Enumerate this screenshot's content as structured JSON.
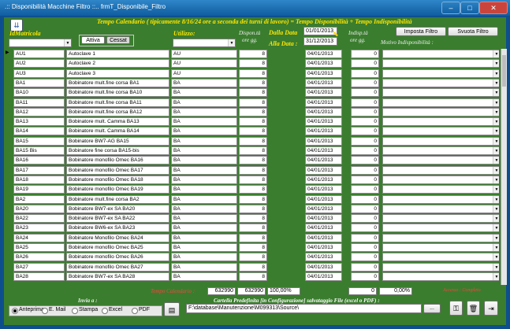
{
  "window": {
    "title": ".:: Disponibilità Macchine Filtro ::..   frmT_Disponibile_Filtro"
  },
  "header": {
    "banner": "Tempo Calendario ( tipicamente  8/16/24 ore a seconda dei turni di lavoro) = Tempo Disponibilità + Tempo Indisponibilità",
    "matricola_label": "IdMatricola",
    "attiva": "Attiva",
    "cessat": "Cessat",
    "utilizzo_label": "Utilizzo:",
    "dispon_label": "Dispon.tà",
    "ore_gg": "ore gg.",
    "dalla_data_label": "Dalla Data",
    "alla_data_label": "Alla Data :",
    "dalla_data": "01/01/2013",
    "alla_data": "31/12/2013",
    "indisp_label": "Indisp.tà",
    "motivo_label": "Motivo Indisponibilità :",
    "imposta_filtro": "Imposta Filtro",
    "svuota_filtro": "Svuota Filtro"
  },
  "rows": [
    {
      "id": "AU1",
      "desc": "Autoclave 1",
      "util": "AU",
      "ore": "8",
      "data": "04/01/2013",
      "indisp": "0"
    },
    {
      "id": "AU2",
      "desc": "Autoclave 2",
      "util": "AU",
      "ore": "8",
      "data": "04/01/2013",
      "indisp": "0"
    },
    {
      "id": "AU3",
      "desc": "Autoclave 3",
      "util": "AU",
      "ore": "8",
      "data": "04/01/2013",
      "indisp": "0"
    },
    {
      "id": "BA1",
      "desc": "Bobinatore mult.fine corsa BA1",
      "util": "BA",
      "ore": "8",
      "data": "04/01/2013",
      "indisp": "0"
    },
    {
      "id": "BA10",
      "desc": "Bobinatore mult.fine corsa BA10",
      "util": "BA",
      "ore": "8",
      "data": "04/01/2013",
      "indisp": "0"
    },
    {
      "id": "BA11",
      "desc": "Bobinatore mult.fine corsa BA11",
      "util": "BA",
      "ore": "8",
      "data": "04/01/2013",
      "indisp": "0"
    },
    {
      "id": "BA12",
      "desc": "Bobinatore mult.fine corsa BA12",
      "util": "BA",
      "ore": "8",
      "data": "04/01/2013",
      "indisp": "0"
    },
    {
      "id": "BA13",
      "desc": "Bobinatore mult. Camma BA13",
      "util": "BA",
      "ore": "8",
      "data": "04/01/2013",
      "indisp": "0"
    },
    {
      "id": "BA14",
      "desc": "Bobinatore mult. Camma BA14",
      "util": "BA",
      "ore": "8",
      "data": "04/01/2013",
      "indisp": "0"
    },
    {
      "id": "BA15",
      "desc": "Bobinatore BW7-AG BA15",
      "util": "BA",
      "ore": "8",
      "data": "04/01/2013",
      "indisp": "0"
    },
    {
      "id": "BA15 Bis",
      "desc": "Bobinatore fine corsa BA15-bis",
      "util": "BA",
      "ore": "8",
      "data": "04/01/2013",
      "indisp": "0"
    },
    {
      "id": "BA16",
      "desc": "Bobinatore monofilo Omec BA16",
      "util": "BA",
      "ore": "8",
      "data": "04/01/2013",
      "indisp": "0"
    },
    {
      "id": "BA17",
      "desc": "Bobinatore monofilo Omec BA17",
      "util": "BA",
      "ore": "8",
      "data": "04/01/2013",
      "indisp": "0"
    },
    {
      "id": "BA18",
      "desc": "Bobinatore monofilo Omec BA18",
      "util": "BA",
      "ore": "8",
      "data": "04/01/2013",
      "indisp": "0"
    },
    {
      "id": "BA19",
      "desc": "Bobinatore monofilo Omec BA19",
      "util": "BA",
      "ore": "8",
      "data": "04/01/2013",
      "indisp": "0"
    },
    {
      "id": "BA2",
      "desc": "Bobinatore mult.fine corsa BA2",
      "util": "BA",
      "ore": "8",
      "data": "04/01/2013",
      "indisp": "0"
    },
    {
      "id": "BA20",
      "desc": "Bobinatore BW7-ex SA BA20",
      "util": "BA",
      "ore": "8",
      "data": "04/01/2013",
      "indisp": "0"
    },
    {
      "id": "BA22",
      "desc": "Bobinatore BW7-ex SA BA22",
      "util": "BA",
      "ore": "8",
      "data": "04/01/2013",
      "indisp": "0"
    },
    {
      "id": "BA23",
      "desc": "Bobinatore BW6-ex SA BA23",
      "util": "BA",
      "ore": "8",
      "data": "04/01/2013",
      "indisp": "0"
    },
    {
      "id": "BA24",
      "desc": "Bobinatore Monofilo Omec BA24",
      "util": "BA",
      "ore": "8",
      "data": "04/01/2013",
      "indisp": "0"
    },
    {
      "id": "BA25",
      "desc": "Bobinatore monofilo Omec BA25",
      "util": "BA",
      "ore": "8",
      "data": "04/01/2013",
      "indisp": "0"
    },
    {
      "id": "BA26",
      "desc": "Bobinatore monofilo Omec BA26",
      "util": "BA",
      "ore": "8",
      "data": "04/01/2013",
      "indisp": "0"
    },
    {
      "id": "BA27",
      "desc": "Bobinatore monofilo Omec BA27",
      "util": "BA",
      "ore": "8",
      "data": "04/01/2013",
      "indisp": "0"
    },
    {
      "id": "BA28",
      "desc": "Bobinatore BW7-ex SA BA28",
      "util": "BA",
      "ore": "8",
      "data": "04/01/2013",
      "indisp": "0"
    }
  ],
  "footer": {
    "tempo_calendario_label": "Tempo Calendario :",
    "tot1": "632990",
    "tot2": "632990",
    "perc": "100,00%",
    "indisp_tot": "0",
    "indisp_perc": "0,00%",
    "accesso": "Accesso : Completo",
    "invia_label": "Invia a :",
    "cartella_label": "Cartella Predefinita  [in Configurazione] salvataggio File (excel o PDF) :",
    "radios": [
      "Anteprima",
      "E. Mail",
      "Stampa",
      "Excel",
      "PDF"
    ],
    "path": "F:\\database\\Manutenzione\\M099313\\Source\\",
    "browse": "..."
  },
  "colors": {
    "bg": "#3a7d2e",
    "frame": "#0d4f8e",
    "label": "#ffe600"
  }
}
